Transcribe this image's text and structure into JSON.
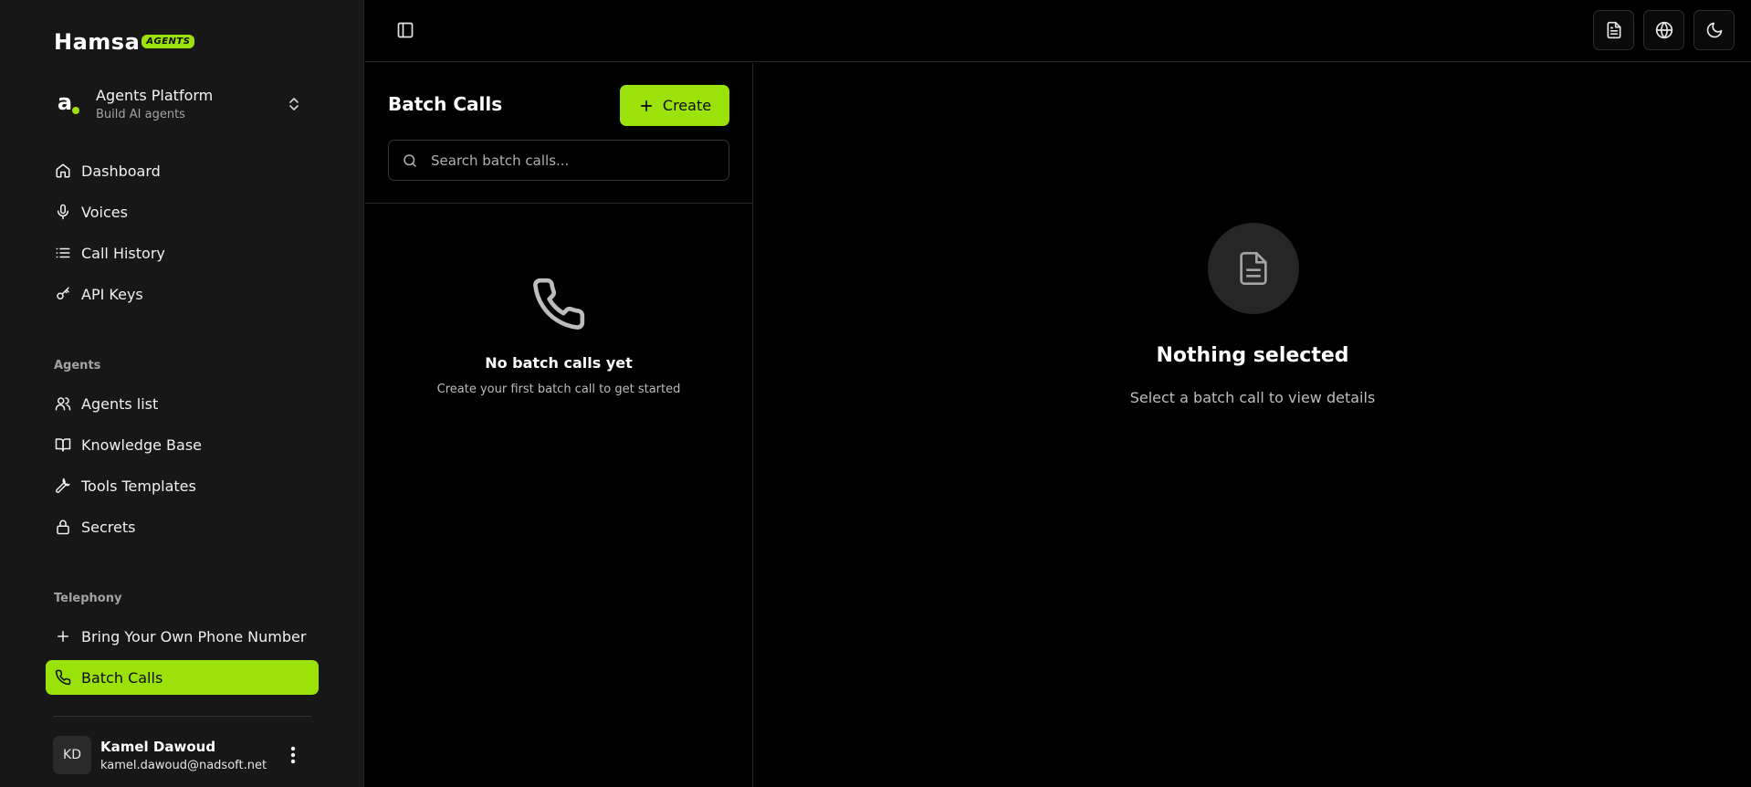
{
  "brand": {
    "word": "Hamsa",
    "tag": "AGENTS",
    "accent": "#9be10a"
  },
  "workspace": {
    "title": "Agents Platform",
    "subtitle": "Build AI agents",
    "avatar_letter": "a"
  },
  "nav_main": [
    {
      "label": "Dashboard",
      "icon": "home-icon"
    },
    {
      "label": "Voices",
      "icon": "microphone-icon"
    },
    {
      "label": "Call History",
      "icon": "list-icon"
    },
    {
      "label": "API Keys",
      "icon": "key-icon"
    }
  ],
  "agents_section": {
    "label": "Agents",
    "items": [
      {
        "label": "Agents list",
        "icon": "users-icon"
      },
      {
        "label": "Knowledge Base",
        "icon": "book-icon"
      },
      {
        "label": "Tools Templates",
        "icon": "wrench-icon"
      },
      {
        "label": "Secrets",
        "icon": "lock-icon"
      }
    ]
  },
  "telephony_section": {
    "label": "Telephony",
    "items": [
      {
        "label": "Bring Your Own Phone Number",
        "icon": "plus-icon"
      },
      {
        "label": "Batch Calls",
        "icon": "phone-icon",
        "active": true
      }
    ]
  },
  "user": {
    "initials": "KD",
    "name": "Kamel Dawoud",
    "email": "kamel.dawoud@nadsoft.net"
  },
  "topbar": {
    "buttons": [
      "document-icon",
      "globe-icon",
      "moon-icon"
    ]
  },
  "list_panel": {
    "title": "Batch Calls",
    "create_label": "Create",
    "search_placeholder": "Search batch calls...",
    "empty_title": "No batch calls yet",
    "empty_subtitle": "Create your first batch call to get started"
  },
  "detail_panel": {
    "title": "Nothing selected",
    "subtitle": "Select a batch call to view details"
  }
}
